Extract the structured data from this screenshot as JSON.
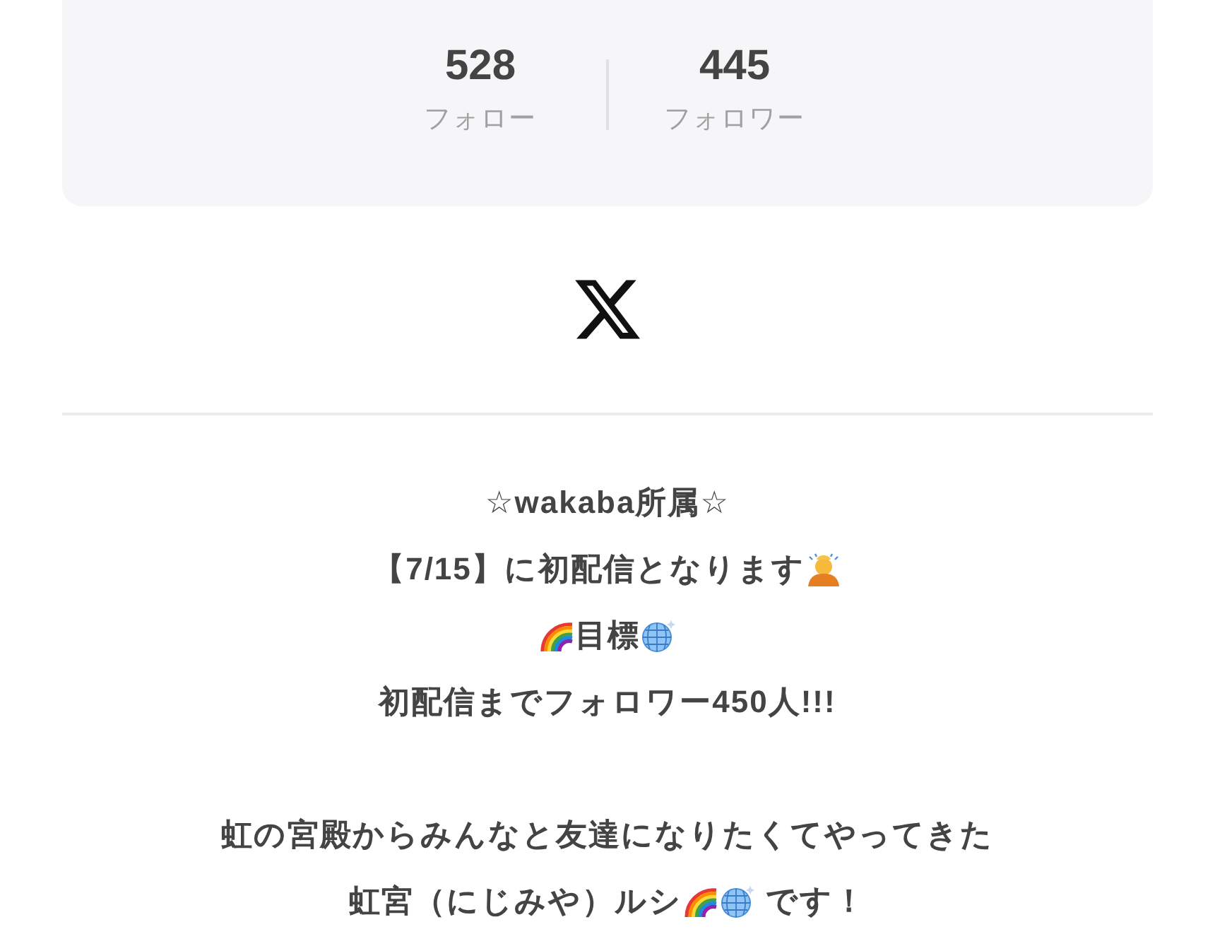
{
  "stats": [
    {
      "count": "528",
      "label": "フォロー"
    },
    {
      "count": "445",
      "label": "フォロワー"
    }
  ],
  "social_links": [
    {
      "kind": "x"
    }
  ],
  "bio": {
    "paragraphs": [
      {
        "lines": [
          [
            {
              "kind": "text",
              "text": "☆wakaba所属☆"
            }
          ],
          [
            {
              "kind": "text",
              "text": "【7/15】に初配信となります"
            },
            {
              "kind": "bowing-person"
            }
          ],
          [
            {
              "kind": "rainbow"
            },
            {
              "kind": "text",
              "text": "目標"
            },
            {
              "kind": "disco-ball"
            }
          ],
          [
            {
              "kind": "text",
              "text": "初配信までフォロワー450人!!!"
            }
          ]
        ]
      },
      {
        "lines": [
          [
            {
              "kind": "text",
              "text": "虹の宮殿からみんなと友達になりたくてやってきた"
            }
          ],
          [
            {
              "kind": "text",
              "text": "虹宮（にじみや）ルシ"
            },
            {
              "kind": "rainbow"
            },
            {
              "kind": "disco-ball"
            },
            {
              "kind": "text",
              "text": " です！"
            }
          ]
        ]
      }
    ]
  }
}
